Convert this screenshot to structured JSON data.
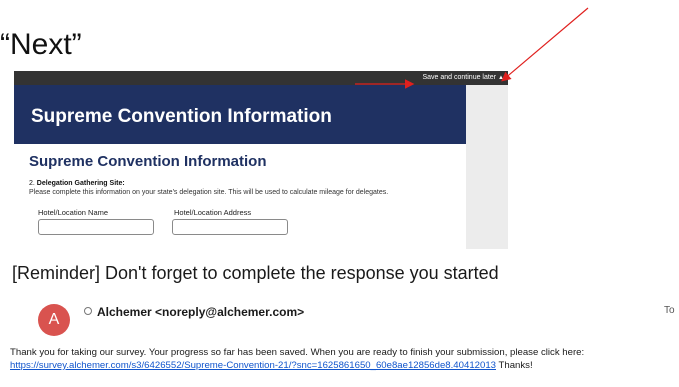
{
  "slide": {
    "title": "“Next”"
  },
  "survey": {
    "topbar": {
      "save_later": "Save and continue later",
      "caret": "▲"
    },
    "banner_title": "Supreme Convention Information",
    "page_heading": "Supreme Convention Information",
    "question": {
      "number": "2.",
      "title": "Delegation Gathering Site:",
      "description": "Please complete this information on your state's delegation site. This will be used to calculate mileage for delegates."
    },
    "fields": [
      {
        "label": "Hotel/Location Name",
        "value": ""
      },
      {
        "label": "Hotel/Location Address",
        "value": ""
      }
    ]
  },
  "email": {
    "subject": "[Reminder] Don't forget to complete the response you started",
    "avatar_letter": "A",
    "sender": "Alchemer <noreply@alchemer.com>",
    "to_label": "To",
    "body_text": "Thank you for taking our survey. Your progress so far has been saved. When you are ready to finish your submission, please click here:",
    "link": "https://survey.alchemer.com/s3/6426552/Supreme-Convention-21/?snc=1625861650_60e8ae12856de8.40412013",
    "thanks": "Thanks!"
  },
  "colors": {
    "banner": "#1f3162",
    "topbar": "#333333",
    "arrow": "#e0201e",
    "avatar": "#d9534f",
    "link": "#1155cc"
  }
}
